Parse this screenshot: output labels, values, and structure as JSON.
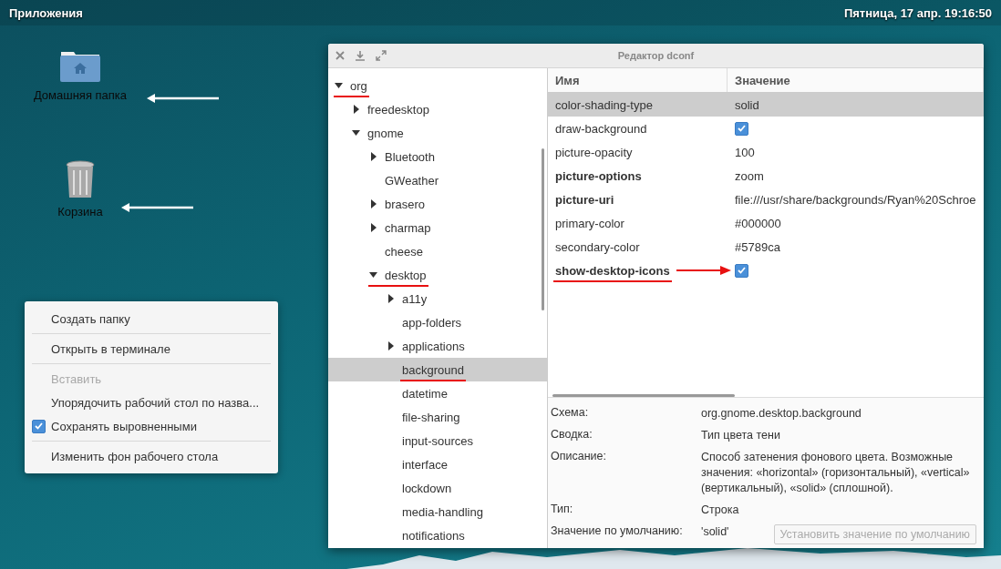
{
  "top_bar": {
    "menu": "Приложения",
    "clock": "Пятница, 17 апр. 19:16:50"
  },
  "desktop_icons": [
    {
      "kind": "home-folder",
      "label": "Домашняя папка",
      "arrow": true
    },
    {
      "kind": "trash",
      "label": "Корзина",
      "arrow": true
    }
  ],
  "context_menu": {
    "items": [
      {
        "kind": "item",
        "label": "Создать папку",
        "disabled": false
      },
      {
        "kind": "separator"
      },
      {
        "kind": "item",
        "label": "Открыть в терминале",
        "disabled": false
      },
      {
        "kind": "separator"
      },
      {
        "kind": "item",
        "label": "Вставить",
        "disabled": true
      },
      {
        "kind": "item",
        "label": "Упорядочить рабочий стол по назва...",
        "disabled": false
      },
      {
        "kind": "check",
        "label": "Сохранять выровненными",
        "disabled": false,
        "checked": true
      },
      {
        "kind": "separator"
      },
      {
        "kind": "item",
        "label": "Изменить фон рабочего стола",
        "disabled": false
      }
    ]
  },
  "window": {
    "title": "Редактор dconf",
    "tree": [
      {
        "label": "org",
        "kind": "branch",
        "expanded": true,
        "selected": false,
        "underlined": true,
        "children": [
          {
            "label": "freedesktop",
            "kind": "branch",
            "expanded": false,
            "selected": false,
            "underlined": false
          },
          {
            "label": "gnome",
            "kind": "branch",
            "expanded": true,
            "selected": false,
            "underlined": false,
            "children": [
              {
                "label": "Bluetooth",
                "kind": "branch",
                "expanded": false,
                "selected": false,
                "underlined": false
              },
              {
                "label": "GWeather",
                "kind": "leaf",
                "selected": false,
                "underlined": false
              },
              {
                "label": "brasero",
                "kind": "branch",
                "expanded": false,
                "selected": false,
                "underlined": false
              },
              {
                "label": "charmap",
                "kind": "branch",
                "expanded": false,
                "selected": false,
                "underlined": false
              },
              {
                "label": "cheese",
                "kind": "leaf",
                "selected": false,
                "underlined": false
              },
              {
                "label": "desktop",
                "kind": "branch",
                "expanded": true,
                "selected": false,
                "underlined": true,
                "children": [
                  {
                    "label": "a11y",
                    "kind": "branch",
                    "expanded": false,
                    "selected": false,
                    "underlined": false
                  },
                  {
                    "label": "app-folders",
                    "kind": "leaf",
                    "selected": false,
                    "underlined": false
                  },
                  {
                    "label": "applications",
                    "kind": "branch",
                    "expanded": false,
                    "selected": false,
                    "underlined": false
                  },
                  {
                    "label": "background",
                    "kind": "leaf",
                    "selected": true,
                    "underlined": true
                  },
                  {
                    "label": "datetime",
                    "kind": "leaf",
                    "selected": false,
                    "underlined": false
                  },
                  {
                    "label": "file-sharing",
                    "kind": "leaf",
                    "selected": false,
                    "underlined": false
                  },
                  {
                    "label": "input-sources",
                    "kind": "leaf",
                    "selected": false,
                    "underlined": false
                  },
                  {
                    "label": "interface",
                    "kind": "leaf",
                    "selected": false,
                    "underlined": false
                  },
                  {
                    "label": "lockdown",
                    "kind": "leaf",
                    "selected": false,
                    "underlined": false
                  },
                  {
                    "label": "media-handling",
                    "kind": "leaf",
                    "selected": false,
                    "underlined": false
                  },
                  {
                    "label": "notifications",
                    "kind": "leaf",
                    "selected": false,
                    "underlined": false
                  }
                ]
              }
            ]
          }
        ]
      }
    ],
    "table": {
      "columns": [
        "Имя",
        "Значение"
      ],
      "rows": [
        {
          "name": "color-shading-type",
          "kind": "text",
          "value": "solid",
          "bold": false,
          "selected": true,
          "underlined": false,
          "arrow": false
        },
        {
          "name": "draw-background",
          "kind": "checkbox",
          "checked": true,
          "bold": false,
          "selected": false,
          "underlined": false,
          "arrow": false
        },
        {
          "name": "picture-opacity",
          "kind": "text",
          "value": "100",
          "bold": false,
          "selected": false,
          "underlined": false,
          "arrow": false
        },
        {
          "name": "picture-options",
          "kind": "text",
          "value": "zoom",
          "bold": true,
          "selected": false,
          "underlined": false,
          "arrow": false
        },
        {
          "name": "picture-uri",
          "kind": "text",
          "value": "file:///usr/share/backgrounds/Ryan%20Schroe",
          "bold": true,
          "selected": false,
          "underlined": false,
          "arrow": false
        },
        {
          "name": "primary-color",
          "kind": "text",
          "value": "#000000",
          "bold": false,
          "selected": false,
          "underlined": false,
          "arrow": false
        },
        {
          "name": "secondary-color",
          "kind": "text",
          "value": "#5789ca",
          "bold": false,
          "selected": false,
          "underlined": false,
          "arrow": false
        },
        {
          "name": "show-desktop-icons",
          "kind": "checkbox",
          "checked": true,
          "bold": true,
          "selected": false,
          "underlined": true,
          "arrow": true
        }
      ]
    },
    "details": [
      {
        "label": "Схема:",
        "value": "org.gnome.desktop.background"
      },
      {
        "label": "Сводка:",
        "value": "Тип цвета тени"
      },
      {
        "label": "Описание:",
        "value": "Способ затенения фонового цвета. Возможные значения: «horizontal» (горизонтальный), «vertical» (вертикальный), «solid» (сплошной)."
      },
      {
        "label": "Тип:",
        "value": "Строка"
      },
      {
        "label": "Значение по умолчанию:",
        "value": "'solid'"
      }
    ],
    "reset_button": {
      "label": "Установить значение по умолчанию",
      "disabled": true
    }
  }
}
